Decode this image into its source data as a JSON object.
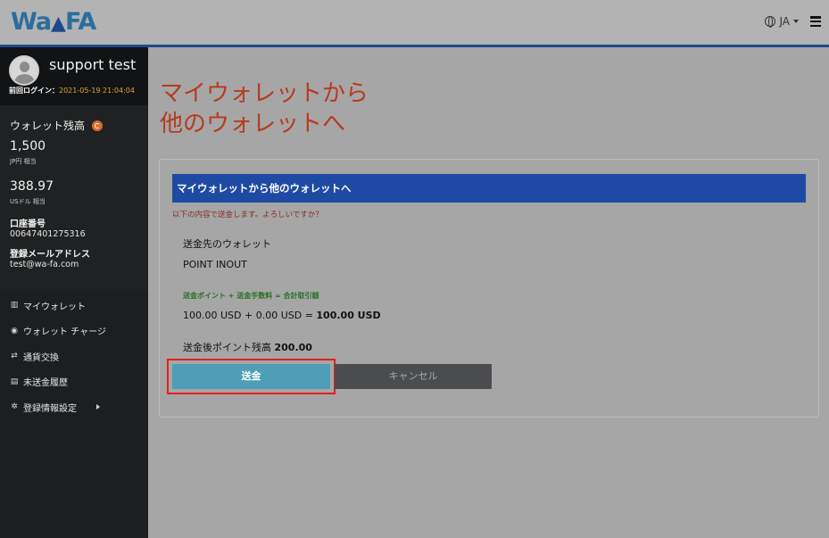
{
  "header": {
    "logo_text": "Wa",
    "logo_text2": "FA",
    "language": "JA"
  },
  "sidebar": {
    "username": "support test",
    "last_login_label": "前回ログイン：",
    "last_login_value": "2021-05-19 21:04:04",
    "balance_title": "ウォレット残高",
    "balances": [
      {
        "amount": "1,500",
        "unit": "JP円 相当"
      },
      {
        "amount": "388.97",
        "unit": "USドル 相当"
      }
    ],
    "account_number_label": "口座番号",
    "account_number": "00647401275316",
    "email_label": "登録メールアドレス",
    "email": "test@wa-fa.com",
    "menu": [
      {
        "label": "マイウォレット",
        "icon": "bank-icon"
      },
      {
        "label": "ウォレット チャージ",
        "icon": "coins-icon"
      },
      {
        "label": "通貨交換",
        "icon": "exchange-icon"
      },
      {
        "label": "未送金履歴",
        "icon": "history-icon"
      },
      {
        "label": "登録情報設定",
        "icon": "gear-icon"
      }
    ]
  },
  "main": {
    "title_line1": "マイウォレットから",
    "title_line2": "他のウォレットへ",
    "card_header": "マイウォレットから他のウォレットへ",
    "confirm_message": "以下の内容で送金します。よろしいですか？",
    "destination_label": "送金先のウォレット",
    "destination_value": "POINT INOUT",
    "formula_label": "送金ポイント + 送金手数料 = 合計取引額",
    "formula_prefix": "100.00 USD + 0.00 USD = ",
    "formula_total": "100.00 USD",
    "after_balance_label": "送金後ポイント残高 ",
    "after_balance_value": "200.00",
    "send_button": "送金",
    "cancel_button": "キャンセル"
  }
}
